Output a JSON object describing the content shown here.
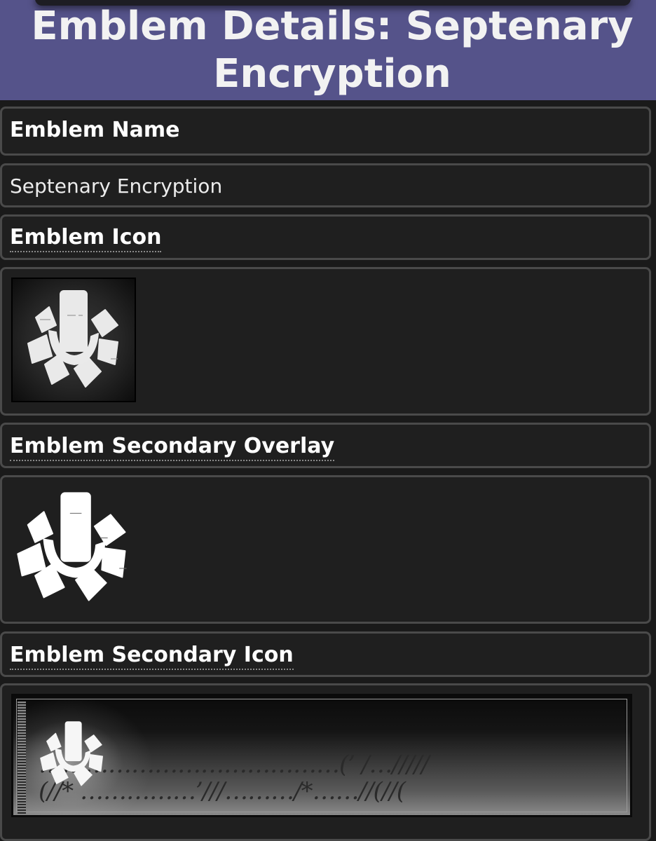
{
  "page": {
    "title": "Emblem Details: Septenary Encryption"
  },
  "sections": {
    "name_header": "Emblem Name",
    "name_value": "Septenary Encryption",
    "icon_header": "Emblem Icon",
    "overlay_header": "Emblem Secondary Overlay",
    "secondary_icon_header": "Emblem Secondary Icon"
  },
  "images": {
    "emblem_icon": "septenary-encryption-emblem-icon",
    "secondary_overlay": "septenary-encryption-secondary-overlay",
    "secondary_icon": "septenary-encryption-secondary-banner"
  },
  "colors": {
    "header_bg": "#55538a",
    "page_bg": "#1a1a1a",
    "box_bg": "#1f1f1f",
    "box_border": "#4a4a4a"
  }
}
